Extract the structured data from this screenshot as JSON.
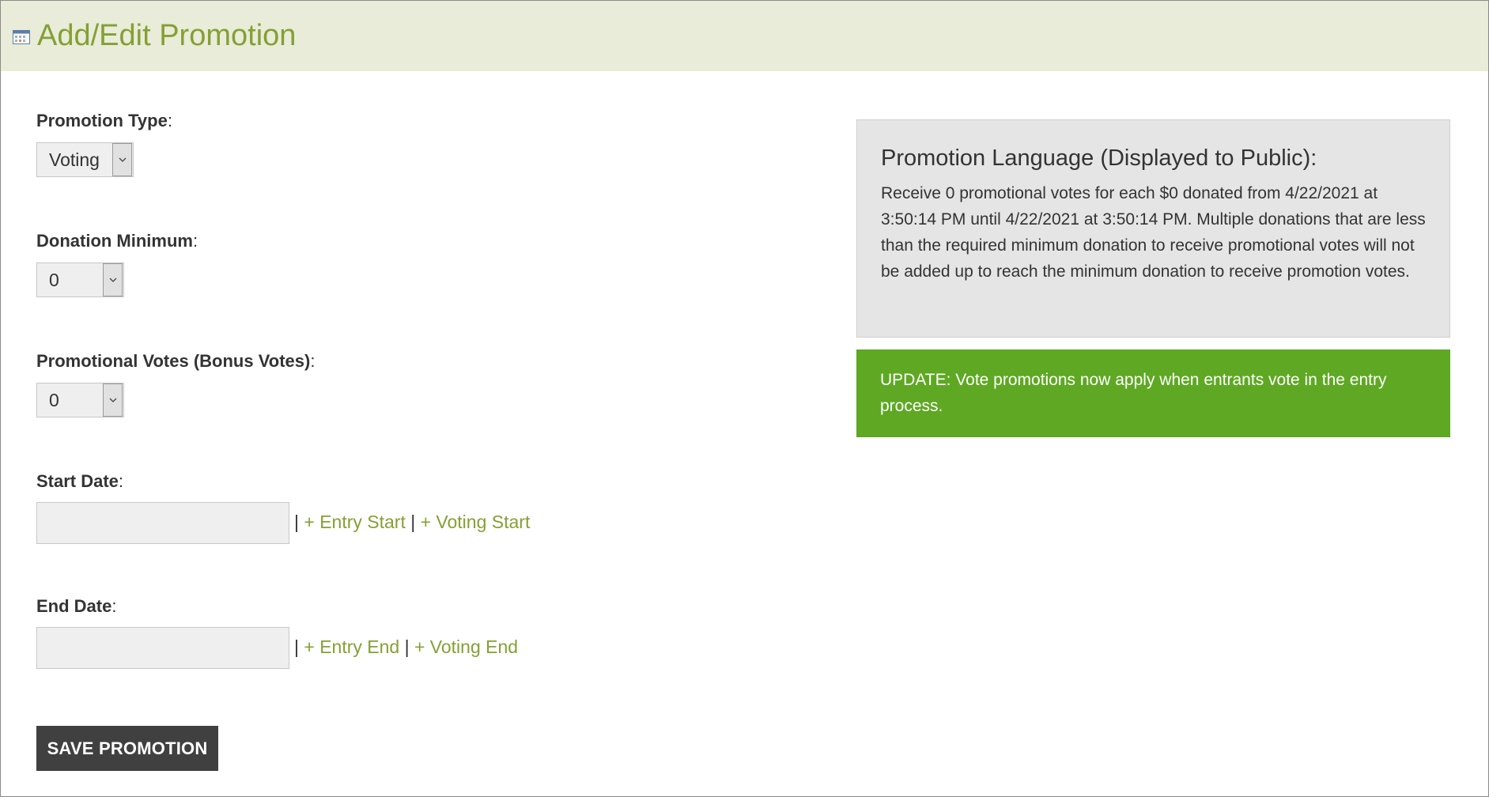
{
  "header": {
    "title": "Add/Edit Promotion",
    "icon": "calendar-icon"
  },
  "form": {
    "promotion_type": {
      "label": "Promotion Type",
      "value": "Voting"
    },
    "donation_minimum": {
      "label": "Donation Minimum",
      "value": "0"
    },
    "promotional_votes": {
      "label": "Promotional Votes (Bonus Votes)",
      "value": "0"
    },
    "start_date": {
      "label": "Start Date",
      "value": "",
      "links": [
        "+ Entry Start",
        "+ Voting Start"
      ]
    },
    "end_date": {
      "label": "End Date",
      "value": "",
      "links": [
        "+ Entry End",
        "+ Voting End"
      ]
    },
    "colon": ":",
    "separator": "|",
    "save_label": "SAVE PROMOTION"
  },
  "promotion_language": {
    "title": "Promotion Language (Displayed to Public):",
    "text": "Receive 0 promotional votes for each $0 donated from 4/22/2021 at 3:50:14 PM until 4/22/2021 at 3:50:14 PM. Multiple donations that are less than the required minimum donation to receive promotional votes will not be added up to reach the minimum donation to receive promotion votes."
  },
  "update_notice": {
    "text": "UPDATE: Vote promotions now apply when entrants vote in the entry process."
  },
  "colors": {
    "accent": "#84a033",
    "header_bg": "#e8ecd9",
    "update_bg": "#5ea823",
    "button_bg": "#404040"
  }
}
